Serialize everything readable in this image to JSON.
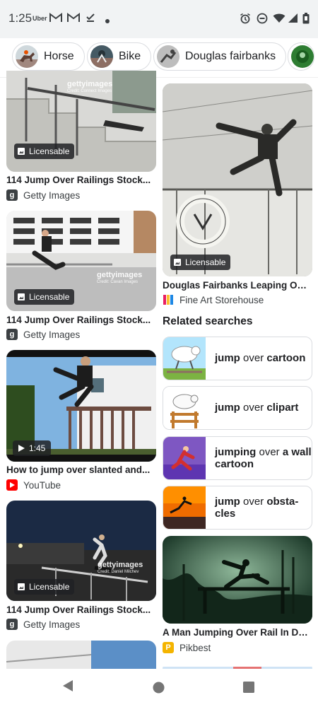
{
  "status_bar": {
    "time": "1:25",
    "carrier_label": "Uber",
    "icons": [
      "gmail-icon",
      "gmail-icon",
      "task-done-icon",
      "dot-icon",
      "alarm-icon",
      "dnd-icon",
      "wifi-icon",
      "signal-icon",
      "battery-icon"
    ]
  },
  "chips": [
    {
      "label": "Horse",
      "icon": "horse-thumbnail"
    },
    {
      "label": "Bike",
      "icon": "bike-thumbnail"
    },
    {
      "label": "Douglas fairbanks",
      "icon": "douglas-fairbanks-thumbnail"
    },
    {
      "label": "",
      "icon": "more-thumbnail"
    }
  ],
  "results": [
    {
      "title": "114 Jump Over Railings Stock...",
      "source": "Getty Images",
      "badge": "Licensable",
      "watermark": "gettyimages",
      "watermark_credit": "Credit: Connect Images"
    },
    {
      "title": "114 Jump Over Railings Stock...",
      "source": "Getty Images",
      "badge": "Licensable",
      "watermark": "gettyimages",
      "watermark_credit": "Credit: Cavan Images"
    },
    {
      "title": "How to jump over slanted and...",
      "source": "YouTube",
      "duration": "1:45"
    },
    {
      "title": "114 Jump Over Railings Stock...",
      "source": "Getty Images",
      "badge": "Licensable",
      "watermark": "gettyimages",
      "watermark_credit": "Credit: Daniel Milchev"
    },
    {
      "title": "Douglas Fairbanks Leaping Ove...",
      "source": "Fine Art Storehouse",
      "badge": "Licensable"
    },
    {
      "title": "A Man Jumping Over Rail In Dar...",
      "source": "Pikbest"
    }
  ],
  "related": {
    "heading": "Related searches",
    "items": [
      {
        "bold1": "jump",
        "normal": " over ",
        "bold2": "cartoon"
      },
      {
        "bold1": "jump",
        "normal": " over ",
        "bold2": "clipart"
      },
      {
        "bold1": "jumping",
        "normal": " over ",
        "bold2": "a wall cartoon"
      },
      {
        "bold1": "jump",
        "normal": " over ",
        "bold2": "obsta-cles"
      }
    ]
  },
  "nav": {
    "icons": [
      "back-icon",
      "home-icon",
      "recents-icon"
    ]
  },
  "colors": {
    "youtube": "#ff0000",
    "getty": "#3c4043",
    "pikbest": "#f4b400",
    "chip_border": "#dadce0"
  }
}
